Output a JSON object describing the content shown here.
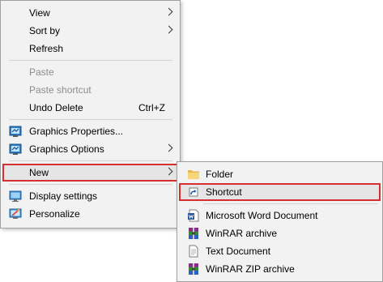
{
  "main_menu": {
    "items": [
      {
        "label": "View",
        "has_submenu": true
      },
      {
        "label": "Sort by",
        "has_submenu": true
      },
      {
        "label": "Refresh"
      },
      {
        "label": "Paste",
        "disabled": true
      },
      {
        "label": "Paste shortcut",
        "disabled": true
      },
      {
        "label": "Undo Delete",
        "shortcut": "Ctrl+Z"
      },
      {
        "label": "Graphics Properties...",
        "icon": "intel-graphics-icon"
      },
      {
        "label": "Graphics Options",
        "icon": "intel-graphics-icon",
        "has_submenu": true
      },
      {
        "label": "New",
        "has_submenu": true,
        "highlighted": true
      },
      {
        "label": "Display settings",
        "icon": "display-icon"
      },
      {
        "label": "Personalize",
        "icon": "personalize-icon"
      }
    ]
  },
  "new_submenu": {
    "items": [
      {
        "label": "Folder",
        "icon": "folder-icon"
      },
      {
        "label": "Shortcut",
        "icon": "shortcut-icon",
        "highlighted": true
      },
      {
        "label": "Microsoft Word Document",
        "icon": "word-document-icon"
      },
      {
        "label": "WinRAR archive",
        "icon": "winrar-icon"
      },
      {
        "label": "Text Document",
        "icon": "text-document-icon"
      },
      {
        "label": "WinRAR ZIP archive",
        "icon": "winrar-zip-icon"
      }
    ]
  },
  "colors": {
    "menu_background": "#f2f2f2",
    "menu_border": "#a0a0a0",
    "highlight_outline": "#d62f2f",
    "disabled_text": "#8d8d8d"
  }
}
